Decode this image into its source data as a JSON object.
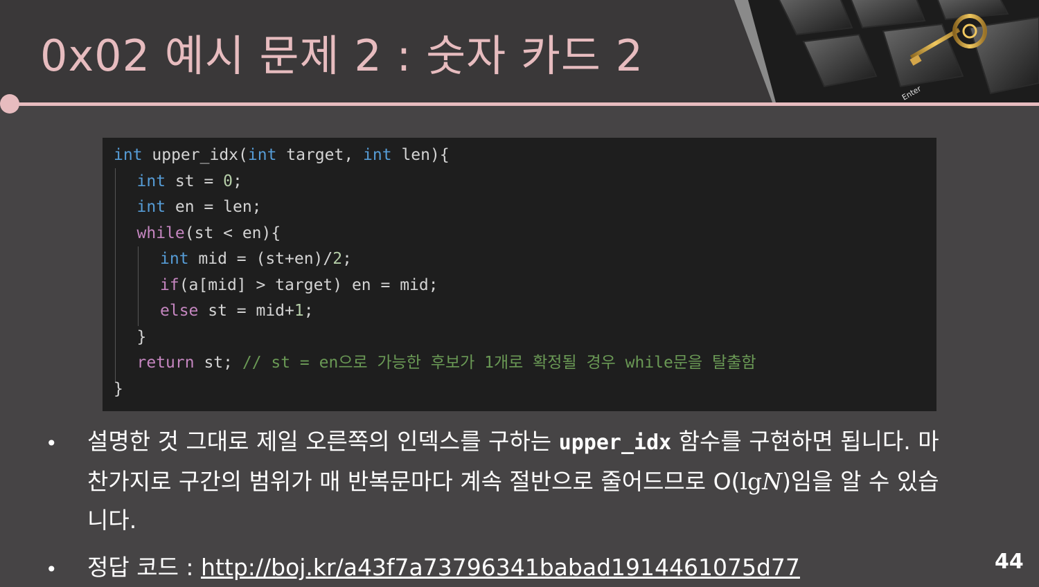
{
  "slide": {
    "title": "0x02  예시 문제 2 : 숫자 카드 2",
    "page_number": "44",
    "accent_color": "#e7bcbf"
  },
  "code": {
    "lines": [
      [
        [
          "kw",
          "int"
        ],
        [
          "t",
          " upper_idx("
        ],
        [
          "kw",
          "int"
        ],
        [
          "t",
          " target, "
        ],
        [
          "kw",
          "int"
        ],
        [
          "t",
          " len){"
        ]
      ],
      [
        [
          "kw",
          "int"
        ],
        [
          "t",
          " st = "
        ],
        [
          "num",
          "0"
        ],
        [
          "t",
          ";"
        ]
      ],
      [
        [
          "kw",
          "int"
        ],
        [
          "t",
          " en = len;"
        ]
      ],
      [
        [
          "ctl",
          "while"
        ],
        [
          "t",
          "(st < en){"
        ]
      ],
      [
        [
          "kw",
          "int"
        ],
        [
          "t",
          " mid = (st+en)/"
        ],
        [
          "num",
          "2"
        ],
        [
          "t",
          ";"
        ]
      ],
      [
        [
          "ctl",
          "if"
        ],
        [
          "t",
          "(a[mid] > target) en = mid;"
        ]
      ],
      [
        [
          "ctl",
          "else"
        ],
        [
          "t",
          " st = mid+"
        ],
        [
          "num",
          "1"
        ],
        [
          "t",
          ";"
        ]
      ],
      [
        [
          "t",
          "}"
        ]
      ],
      [
        [
          "ctl",
          "return"
        ],
        [
          "t",
          " st; "
        ],
        [
          "cm",
          "// st = en으로 가능한 후보가 1개로 확정될 경우 while문을 탈출함"
        ]
      ],
      [
        [
          "t",
          "}"
        ]
      ]
    ]
  },
  "bullets": {
    "b1_part1": "설명한 것 그대로 제일 오른쪽의 인덱스를 구하는 ",
    "b1_code": "upper_idx",
    "b1_part2": " 함수를 구현하면 됩니다. 마찬가지로 구간의 범위가 매 반복문마다 계속 절반으로 줄어드므로 O(",
    "b1_lg": "lg",
    "b1_n": "N",
    "b1_part3": ")임을 알 수 있습니다.",
    "b2_label": "정답 코드 : ",
    "b2_link": "http://boj.kr/a43f7a73796341babad1914461075d77",
    "bullet_char": "•"
  },
  "image": {
    "icon": "keyboard-key-photo",
    "key_label": "Enter"
  }
}
